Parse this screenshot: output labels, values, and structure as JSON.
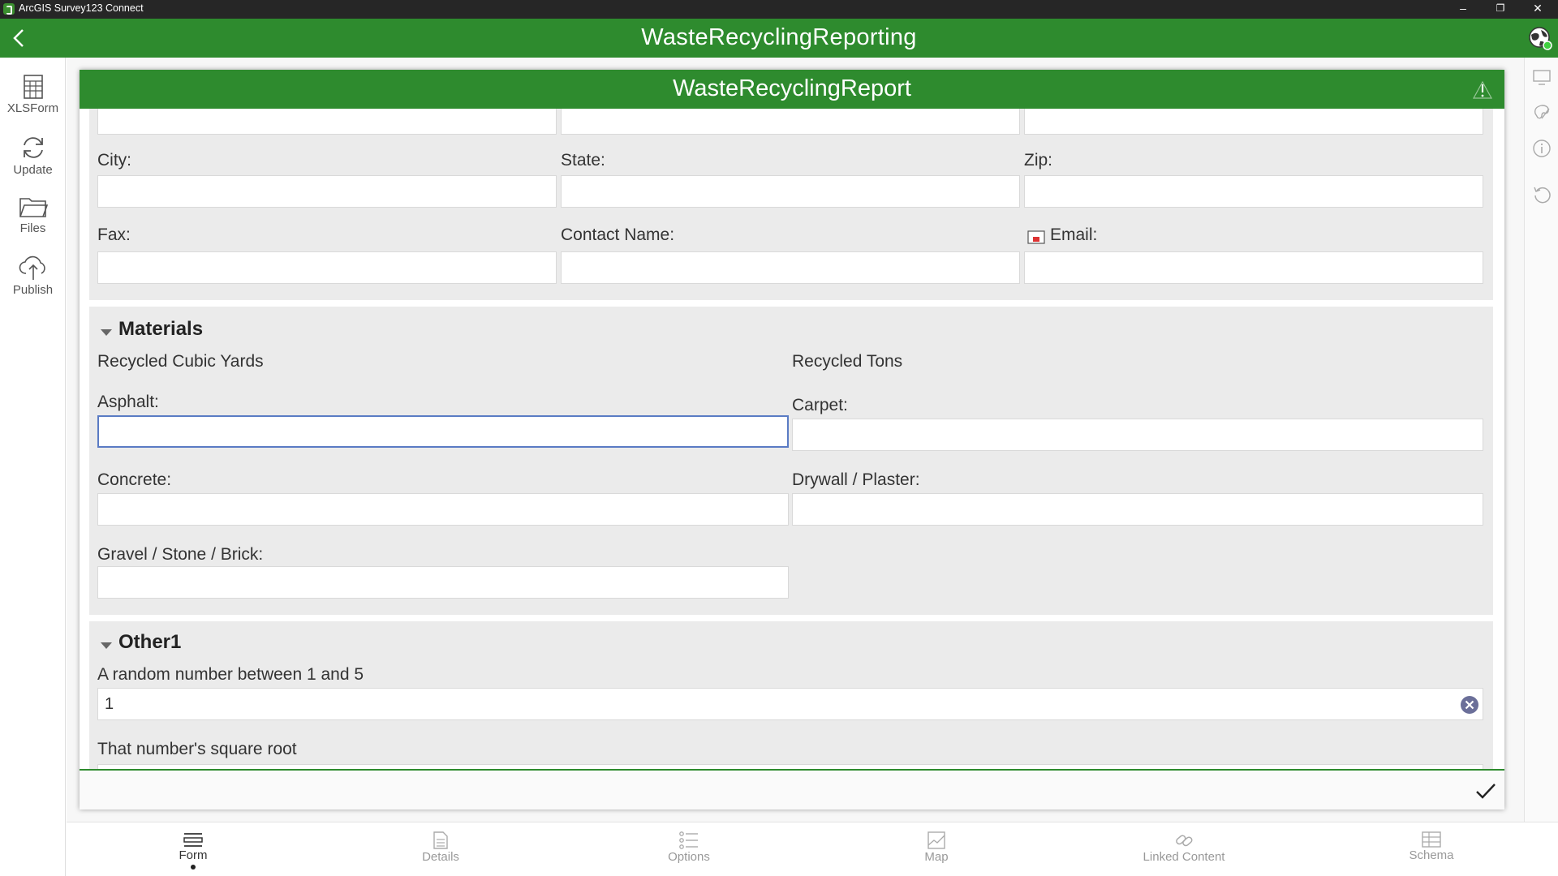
{
  "window": {
    "title": "ArcGIS Survey123 Connect",
    "minimize": "–",
    "restore": "❐",
    "close": "✕"
  },
  "header": {
    "title": "WasteRecyclingReporting"
  },
  "leftnav": {
    "items": [
      {
        "label": "XLSForm",
        "icon": "spreadsheet-icon"
      },
      {
        "label": "Update",
        "icon": "refresh-icon"
      },
      {
        "label": "Files",
        "icon": "folder-icon"
      },
      {
        "label": "Publish",
        "icon": "cloud-upload-icon"
      }
    ]
  },
  "form": {
    "title": "WasteRecyclingReport",
    "contact": {
      "city_label": "City:",
      "state_label": "State:",
      "zip_label": "Zip:",
      "fax_label": "Fax:",
      "contact_name_label": "Contact Name:",
      "email_label": "Email:"
    },
    "materials": {
      "title": "Materials",
      "col1_header": "Recycled Cubic Yards",
      "col2_header": "Recycled Tons",
      "asphalt_label": "Asphalt:",
      "carpet_label": "Carpet:",
      "concrete_label": "Concrete:",
      "drywall_label": "Drywall / Plaster:",
      "gravel_label": "Gravel / Stone / Brick:"
    },
    "other": {
      "title": "Other1",
      "random_label": "A random number between 1 and 5",
      "random_value": "1",
      "sqrt_label": "That number's square root"
    }
  },
  "bottom_tabs": [
    {
      "label": "Form",
      "active": true
    },
    {
      "label": "Details",
      "active": false
    },
    {
      "label": "Options",
      "active": false
    },
    {
      "label": "Map",
      "active": false
    },
    {
      "label": "Linked Content",
      "active": false
    },
    {
      "label": "Schema",
      "active": false
    }
  ],
  "colors": {
    "brand_green": "#2e8b2e",
    "titlebar": "#262626",
    "focus_border": "#5a7bc4"
  }
}
